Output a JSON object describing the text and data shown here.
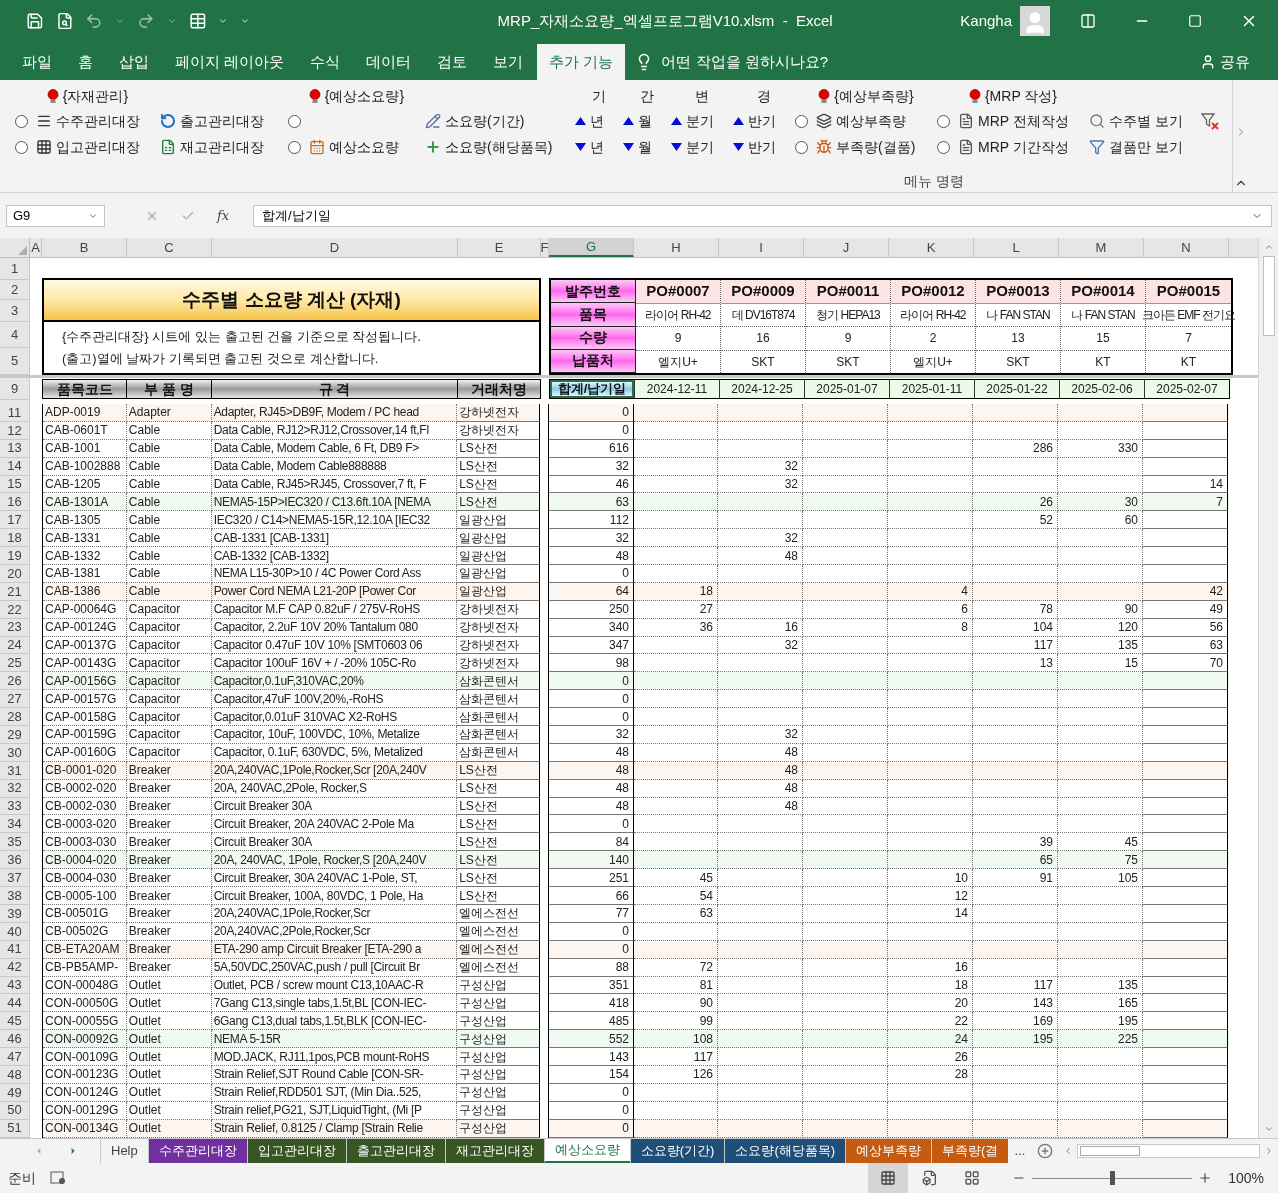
{
  "title_bar": {
    "title": "MRP_자재소요량_엑셀프로그램V10.xlsm  -  Excel",
    "user": "Kangha"
  },
  "ribbon_tabs": [
    {
      "label": "파일",
      "selected": false
    },
    {
      "label": "홈",
      "selected": false
    },
    {
      "label": "삽입",
      "selected": false
    },
    {
      "label": "페이지 레이아웃",
      "selected": false
    },
    {
      "label": "수식",
      "selected": false
    },
    {
      "label": "데이터",
      "selected": false
    },
    {
      "label": "검토",
      "selected": false
    },
    {
      "label": "보기",
      "selected": false
    },
    {
      "label": "추가 기능",
      "selected": true
    }
  ],
  "tell_me": "어떤 작업을 원하시나요?",
  "share": "공유",
  "ribbon": {
    "group_label": "메뉴 명령",
    "columns": [
      {
        "header": {
          "text": "{자재관리}",
          "kind": "bulb"
        },
        "cells": [
          {
            "kind": "radio_button",
            "selected": false,
            "label": "수주관리대장"
          },
          {
            "kind": "radio_button",
            "selected": false,
            "label": "입고관리대장"
          }
        ]
      },
      {
        "cells": [
          {
            "kind": "button",
            "label": "출고관리대장"
          },
          {
            "kind": "button",
            "label": "재고관리대장"
          }
        ]
      },
      {
        "header": {
          "text": "{예상소요량}",
          "kind": "bulb"
        },
        "cells": [
          {
            "kind": "radio",
            "selected": false
          },
          {
            "kind": "radio_button",
            "selected": false,
            "label": "예상소요량"
          }
        ]
      },
      {
        "cells": [
          {
            "kind": "button",
            "label": "소요량(기간)"
          },
          {
            "kind": "button",
            "label": "소요량(해당품목)"
          }
        ]
      },
      {
        "header": {
          "text": "기",
          "kind": "plain"
        },
        "cells": [
          {
            "kind": "arrow_up",
            "label": "년"
          },
          {
            "kind": "arrow_down",
            "label": "년"
          }
        ]
      },
      {
        "header": {
          "text": "간",
          "kind": "plain"
        },
        "cells": [
          {
            "kind": "arrow_up",
            "label": "월"
          },
          {
            "kind": "arrow_down",
            "label": "월"
          }
        ]
      },
      {
        "header": {
          "text": "변",
          "kind": "plain"
        },
        "cells": [
          {
            "kind": "arrow_up",
            "label": "분기"
          },
          {
            "kind": "arrow_down",
            "label": "분기"
          }
        ]
      },
      {
        "header": {
          "text": "경",
          "kind": "plain"
        },
        "cells": [
          {
            "kind": "arrow_up",
            "label": "반기"
          },
          {
            "kind": "arrow_down",
            "label": "반기"
          }
        ]
      },
      {
        "header": {
          "text": "{예상부족량}",
          "kind": "bulb"
        },
        "cells": [
          {
            "kind": "radio_button",
            "selected": false,
            "label": "예상부족량"
          },
          {
            "kind": "radio_button",
            "selected": false,
            "label": "부족량(결품)"
          }
        ]
      },
      {
        "header": {
          "text": "{MRP 작성}",
          "kind": "bulb"
        },
        "cells": [
          {
            "kind": "radio_button",
            "selected": false,
            "label": "MRP 전체작성"
          },
          {
            "kind": "radio_button",
            "selected": false,
            "label": "MRP 기간작성"
          }
        ]
      },
      {
        "cells": [
          {
            "kind": "button",
            "label": "수주별 보기"
          },
          {
            "kind": "button",
            "label": "결품만 보기"
          }
        ]
      },
      {
        "cells": [
          {
            "kind": "icon"
          }
        ]
      }
    ]
  },
  "formula_bar": {
    "name_box": "G9",
    "function_label": "fx",
    "formula": "합계/납기일"
  },
  "columns": [
    {
      "label": "A",
      "selected": false
    },
    {
      "label": "B",
      "selected": false
    },
    {
      "label": "C",
      "selected": false
    },
    {
      "label": "D",
      "selected": false
    },
    {
      "label": "E",
      "selected": false
    },
    {
      "label": "F",
      "selected": false
    },
    {
      "label": "G",
      "selected": true
    },
    {
      "label": "H",
      "selected": false
    },
    {
      "label": "I",
      "selected": false
    },
    {
      "label": "J",
      "selected": false
    },
    {
      "label": "K",
      "selected": false
    },
    {
      "label": "L",
      "selected": false
    },
    {
      "label": "M",
      "selected": false
    },
    {
      "label": "N",
      "selected": false
    }
  ],
  "top_rows": [
    "1",
    "2",
    "3",
    "4",
    "5",
    "9"
  ],
  "title": "수주별 소요량 계산 (자재)",
  "notes": [
    "{수주관리대장} 시트에 있는 출고된 건을 기준으로 작성됩니다.",
    "(출고)열에 날짜가 기록되면 출고된 것으로 계산합니다."
  ],
  "order_labels": [
    "발주번호",
    "품목",
    "수량",
    "납품처"
  ],
  "orders": [
    {
      "po": "PO#0007",
      "item": "라이어 RH-42",
      "qty": "9",
      "customer": "엘지U+",
      "due": "2024-12-11"
    },
    {
      "po": "PO#0009",
      "item": "데 DV16T874",
      "qty": "16",
      "customer": "SKT",
      "due": "2024-12-25"
    },
    {
      "po": "PO#0011",
      "item": "청기 HEPA13",
      "qty": "9",
      "customer": "SKT",
      "due": "2025-01-07"
    },
    {
      "po": "PO#0012",
      "item": "라이어 RH-42",
      "qty": "2",
      "customer": "엘지U+",
      "due": "2025-01-11"
    },
    {
      "po": "PO#0013",
      "item": "나 FAN STAN",
      "qty": "13",
      "customer": "SKT",
      "due": "2025-01-22"
    },
    {
      "po": "PO#0014",
      "item": "나 FAN STAN",
      "qty": "15",
      "customer": "KT",
      "due": "2025-02-06"
    },
    {
      "po": "PO#0015",
      "item": "크아든 EMF 전기요",
      "qty": "7",
      "customer": "KT",
      "due": "2025-02-07"
    }
  ],
  "table_headers": [
    "품목코드",
    "부 품 명",
    "규 격",
    "거래처명"
  ],
  "total_header": "합계/납기일",
  "rows": [
    {
      "row": "11",
      "code": "ADP-0019",
      "name": "Adapter",
      "spec": "Adapter, RJ45>DB9F, Modem / PC head",
      "vendor": "강하넷전자",
      "total": "0",
      "color": "#fdf5ef"
    },
    {
      "row": "12",
      "code": "CAB-0601T",
      "name": "Cable",
      "spec": "Data Cable, RJ12>RJ12,Crossover,14 ft,Fl",
      "vendor": "강하넷전자",
      "total": "0"
    },
    {
      "row": "13",
      "code": "CAB-1001",
      "name": "Cable",
      "spec": "Data Cable, Modem Cable, 6 Ft, DB9 F>",
      "vendor": "LS산전",
      "total": "616",
      "values": {
        "L": "286",
        "M": "330"
      }
    },
    {
      "row": "14",
      "code": "CAB-1002888",
      "name": "Cable",
      "spec": "Data Cable, Modem Cable888888",
      "vendor": "LS산전",
      "total": "32",
      "values": {
        "I": "32"
      }
    },
    {
      "row": "15",
      "code": "CAB-1205",
      "name": "Cable",
      "spec": "Data Cable, RJ45>RJ45, Crossover,7 ft, F",
      "vendor": "LS산전",
      "total": "46",
      "values": {
        "I": "32",
        "N": "14"
      }
    },
    {
      "row": "16",
      "code": "CAB-1301A",
      "name": "Cable",
      "spec": "NEMA5-15P>IEC320 / C13.6ft.10A [NEMA",
      "vendor": "LS산전",
      "total": "63",
      "values": {
        "L": "26",
        "M": "30",
        "N": "7"
      },
      "color": "#f1faf1"
    },
    {
      "row": "17",
      "code": "CAB-1305",
      "name": "Cable",
      "spec": "IEC320 / C14>NEMA5-15R,12.10A [IEC32",
      "vendor": "일광산업",
      "total": "112",
      "values": {
        "L": "52",
        "M": "60"
      }
    },
    {
      "row": "18",
      "code": "CAB-1331",
      "name": "Cable",
      "spec": "CAB-1331 [CAB-1331]",
      "vendor": "일광산업",
      "total": "32",
      "values": {
        "I": "32"
      }
    },
    {
      "row": "19",
      "code": "CAB-1332",
      "name": "Cable",
      "spec": "CAB-1332 [CAB-1332]",
      "vendor": "일광산업",
      "total": "48",
      "values": {
        "I": "48"
      }
    },
    {
      "row": "20",
      "code": "CAB-1381",
      "name": "Cable",
      "spec": "NEMA L15-30P>10 / 4C Power Cord Ass",
      "vendor": "일광산업",
      "total": "0"
    },
    {
      "row": "21",
      "code": "CAB-1386",
      "name": "Cable",
      "spec": "Power Cord NEMA L21-20P [Power Cor",
      "vendor": "일광산업",
      "total": "64",
      "values": {
        "H": "18",
        "K": "4",
        "N": "42"
      },
      "color": "#fdf5ef"
    },
    {
      "row": "22",
      "code": "CAP-00064G",
      "name": "Capacitor",
      "spec": "Capacitor M.F CAP 0.82uF / 275V-RoHS",
      "vendor": "강하넷전자",
      "total": "250",
      "values": {
        "H": "27",
        "K": "6",
        "L": "78",
        "M": "90",
        "N": "49"
      }
    },
    {
      "row": "23",
      "code": "CAP-00124G",
      "name": "Capacitor",
      "spec": "Capacitor, 2.2uF 10V 20% Tantalum 080",
      "vendor": "강하넷전자",
      "total": "340",
      "values": {
        "H": "36",
        "I": "16",
        "K": "8",
        "L": "104",
        "M": "120",
        "N": "56"
      }
    },
    {
      "row": "24",
      "code": "CAP-00137G",
      "name": "Capacitor",
      "spec": "Capacitor 0.47uF 10V 10% [SMT0603 06",
      "vendor": "강하넷전자",
      "total": "347",
      "values": {
        "I": "32",
        "L": "117",
        "M": "135",
        "N": "63"
      }
    },
    {
      "row": "25",
      "code": "CAP-00143G",
      "name": "Capacitor",
      "spec": "Capacitor 100uF 16V + / -20% 105C-Ro",
      "vendor": "강하넷전자",
      "total": "98",
      "values": {
        "L": "13",
        "M": "15",
        "N": "70"
      }
    },
    {
      "row": "26",
      "code": "CAP-00156G",
      "name": "Capacitor",
      "spec": "Capacitor,0.1uF,310VAC,20%",
      "vendor": "삼화콘텐서",
      "total": "0",
      "color": "#f1faf1"
    },
    {
      "row": "27",
      "code": "CAP-00157G",
      "name": "Capacitor",
      "spec": "Capacitor,47uF 100V,20%,-RoHS",
      "vendor": "삼화콘텐서",
      "total": "0"
    },
    {
      "row": "28",
      "code": "CAP-00158G",
      "name": "Capacitor",
      "spec": "Capacitor,0.01uF 310VAC X2-RoHS",
      "vendor": "삼화콘텐서",
      "total": "0"
    },
    {
      "row": "29",
      "code": "CAP-00159G",
      "name": "Capacitor",
      "spec": "Capacitor, 10uF, 100VDC, 10%, Metalize",
      "vendor": "삼화콘텐서",
      "total": "32",
      "values": {
        "I": "32"
      }
    },
    {
      "row": "30",
      "code": "CAP-00160G",
      "name": "Capacitor",
      "spec": "Capacitor, 0.1uF, 630VDC, 5%, Metalized",
      "vendor": "삼화콘텐서",
      "total": "48",
      "values": {
        "I": "48"
      }
    },
    {
      "row": "31",
      "code": "CB-0001-020",
      "name": "Breaker",
      "spec": "20A,240VAC,1Pole,Rocker,Scr [20A,240V",
      "vendor": "LS산전",
      "total": "48",
      "values": {
        "I": "48"
      },
      "color": "#fdf5ef"
    },
    {
      "row": "32",
      "code": "CB-0002-020",
      "name": "Breaker",
      "spec": "20A, 240VAC,2Pole, Rocker,S",
      "vendor": "LS산전",
      "total": "48",
      "values": {
        "I": "48"
      }
    },
    {
      "row": "33",
      "code": "CB-0002-030",
      "name": "Breaker",
      "spec": "Circuit Breaker 30A",
      "vendor": "LS산전",
      "total": "48",
      "values": {
        "I": "48"
      }
    },
    {
      "row": "34",
      "code": "CB-0003-020",
      "name": "Breaker",
      "spec": "Circuit Breaker, 20A 240VAC 2-Pole Ma",
      "vendor": "LS산전",
      "total": "0"
    },
    {
      "row": "35",
      "code": "CB-0003-030",
      "name": "Breaker",
      "spec": "Circuit Breaker 30A",
      "vendor": "LS산전",
      "total": "84",
      "values": {
        "L": "39",
        "M": "45"
      }
    },
    {
      "row": "36",
      "code": "CB-0004-020",
      "name": "Breaker",
      "spec": "20A, 240VAC, 1Pole, Rocker,S [20A,240V",
      "vendor": "LS산전",
      "total": "140",
      "values": {
        "L": "65",
        "M": "75"
      },
      "color": "#f1faf1"
    },
    {
      "row": "37",
      "code": "CB-0004-030",
      "name": "Breaker",
      "spec": "Circuit Breaker, 30A 240VAC 1-Pole, ST,",
      "vendor": "LS산전",
      "total": "251",
      "values": {
        "H": "45",
        "K": "10",
        "L": "91",
        "M": "105"
      }
    },
    {
      "row": "38",
      "code": "CB-0005-100",
      "name": "Breaker",
      "spec": "Circuit Breaker, 100A, 80VDC, 1 Pole, Ha",
      "vendor": "LS산전",
      "total": "66",
      "values": {
        "H": "54",
        "K": "12"
      }
    },
    {
      "row": "39",
      "code": "CB-00501G",
      "name": "Breaker",
      "spec": "20A,240VAC,1Pole,Rocker,Scr",
      "vendor": "엘에스전선",
      "total": "77",
      "values": {
        "H": "63",
        "K": "14"
      }
    },
    {
      "row": "40",
      "code": "CB-00502G",
      "name": "Breaker",
      "spec": "20A,240VAC,2Pole,Rocker,Scr",
      "vendor": "엘에스전선",
      "total": "0"
    },
    {
      "row": "41",
      "code": "CB-ETA20AM",
      "name": "Breaker",
      "spec": "ETA-290 amp Circuit Breaker [ETA-290 a",
      "vendor": "엘에스전선",
      "total": "0",
      "color": "#fdf5ef"
    },
    {
      "row": "42",
      "code": "CB-PB5AMP-",
      "name": "Breaker",
      "spec": "5A,50VDC,250VAC,push / pull [Circuit Br",
      "vendor": "엘에스전선",
      "total": "88",
      "values": {
        "H": "72",
        "K": "16"
      }
    },
    {
      "row": "43",
      "code": "CON-00048G",
      "name": "Outlet",
      "spec": "Outlet, PCB / screw mount C13,10AAC-R",
      "vendor": "구성산업",
      "total": "351",
      "values": {
        "H": "81",
        "K": "18",
        "L": "117",
        "M": "135"
      }
    },
    {
      "row": "44",
      "code": "CON-00050G",
      "name": "Outlet",
      "spec": "7Gang C13,single tabs,1.5t,BL [CON-IEC-",
      "vendor": "구성산업",
      "total": "418",
      "values": {
        "H": "90",
        "K": "20",
        "L": "143",
        "M": "165"
      }
    },
    {
      "row": "45",
      "code": "CON-00055G",
      "name": "Outlet",
      "spec": "6Gang C13,dual tabs,1.5t,BLK [CON-IEC-",
      "vendor": "구성산업",
      "total": "485",
      "values": {
        "H": "99",
        "K": "22",
        "L": "169",
        "M": "195"
      }
    },
    {
      "row": "46",
      "code": "CON-00092G",
      "name": "Outlet",
      "spec": "NEMA 5-15R",
      "vendor": "구성산업",
      "total": "552",
      "values": {
        "H": "108",
        "K": "24",
        "L": "195",
        "M": "225"
      },
      "color": "#f1faf1"
    },
    {
      "row": "47",
      "code": "CON-00109G",
      "name": "Outlet",
      "spec": "MOD.JACK, RJ11,1pos,PCB mount-RoHS",
      "vendor": "구성산업",
      "total": "143",
      "values": {
        "H": "117",
        "K": "26"
      }
    },
    {
      "row": "48",
      "code": "CON-00123G",
      "name": "Outlet",
      "spec": "Strain Relief,SJT Round Cable [CON-SR-",
      "vendor": "구성산업",
      "total": "154",
      "values": {
        "H": "126",
        "K": "28"
      }
    },
    {
      "row": "49",
      "code": "CON-00124G",
      "name": "Outlet",
      "spec": "Strain Relief,RDD501 SJT, (Min Dia..525,",
      "vendor": "구성산업",
      "total": "0"
    },
    {
      "row": "50",
      "code": "CON-00129G",
      "name": "Outlet",
      "spec": "Strain relief,PG21, SJT,LiquidTight, (Mi [P",
      "vendor": "구성산업",
      "total": "0"
    },
    {
      "row": "51",
      "code": "CON-00134G",
      "name": "Outlet",
      "spec": "Strain Relief, 0.8125 / Clamp [Strain Relie",
      "vendor": "구성산업",
      "total": "0",
      "color": "#fdf5ef"
    }
  ],
  "sheet_tabs": [
    {
      "label": "Help",
      "selected": false
    },
    {
      "label": "수주관리대장",
      "selected": false,
      "color": "#7030a0"
    },
    {
      "label": "입고관리대장",
      "selected": false,
      "color": "#375623"
    },
    {
      "label": "출고관리대장",
      "selected": false,
      "color": "#375623"
    },
    {
      "label": "재고관리대장",
      "selected": false,
      "color": "#375623"
    },
    {
      "label": "예상소요량",
      "selected": true
    },
    {
      "label": "소요량(기간)",
      "selected": false,
      "color": "#1f4e78"
    },
    {
      "label": "소요량(해당품목)",
      "selected": false,
      "color": "#1f4e78"
    },
    {
      "label": "예상부족량",
      "selected": false,
      "color": "#c55a11"
    },
    {
      "label": "부족량(결",
      "selected": false,
      "color": "#c55a11"
    }
  ],
  "more_tabs": "...",
  "status": {
    "text": "준비",
    "zoom": "100%",
    "level": 0.5
  }
}
